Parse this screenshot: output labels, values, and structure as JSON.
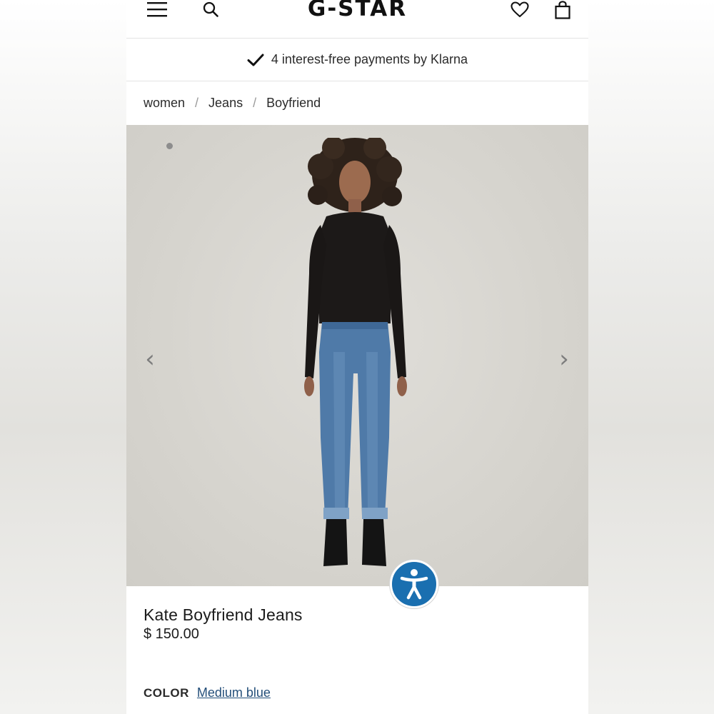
{
  "header": {
    "logo": "G-STAR",
    "menu_icon": "hamburger-menu-icon",
    "search_icon": "search-icon",
    "wishlist_icon": "heart-icon",
    "bag_icon": "shopping-bag-icon"
  },
  "promo": {
    "check_icon": "checkmark-icon",
    "text": "4 interest-free payments by Klarna"
  },
  "breadcrumb": {
    "items": [
      "women",
      "Jeans",
      "Boyfriend"
    ],
    "separator": "/"
  },
  "gallery": {
    "prev_label": "‹",
    "next_label": "›",
    "colors": {
      "background": "#d7d5d0",
      "top": "#1c1918",
      "denim": "#4f7aa8",
      "boots": "#141414"
    }
  },
  "accessibility_icon": "accessibility-icon",
  "product": {
    "title": "Kate Boyfriend Jeans",
    "price": "$ 150.00",
    "color_label": "COLOR",
    "color_value": "Medium blue"
  },
  "colors": {
    "accessibility_button": "#1a6fb0",
    "link": "#244f7a",
    "divider": "#e3e3e3"
  }
}
